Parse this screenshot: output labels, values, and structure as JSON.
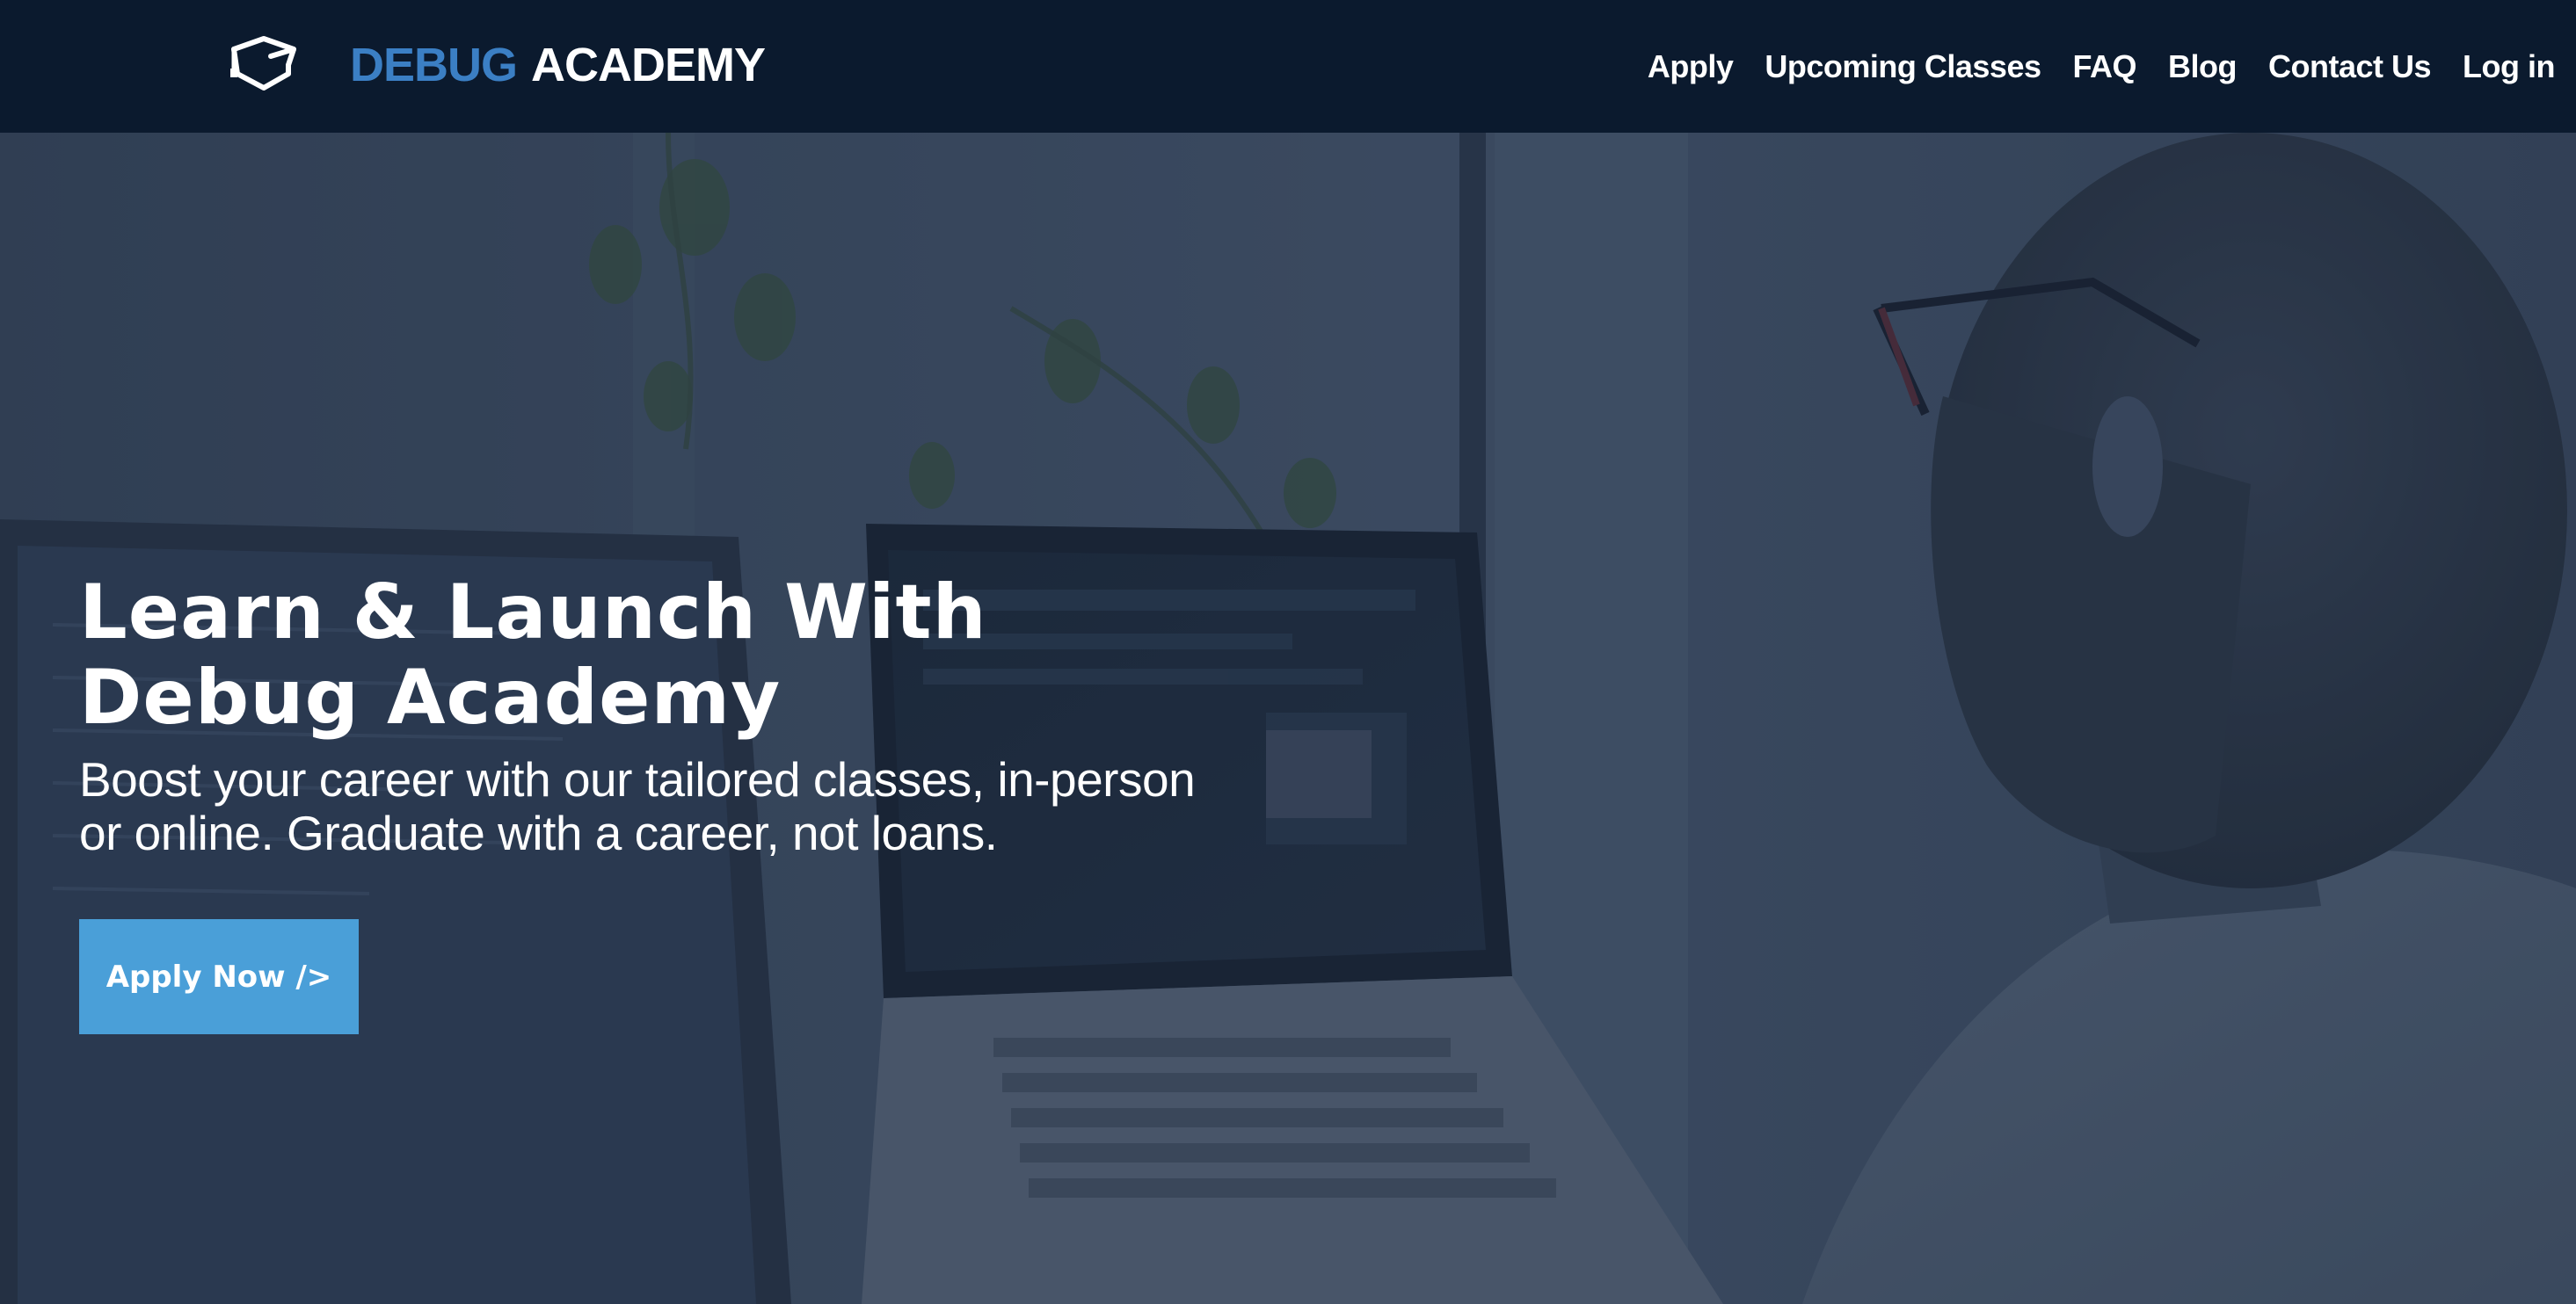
{
  "header": {
    "logo": {
      "word1": "DEBUG",
      "word2": "ACADEMY",
      "icon": "graduation-cap-icon"
    },
    "nav": [
      {
        "label": "Apply"
      },
      {
        "label": "Upcoming Classes"
      },
      {
        "label": "FAQ"
      },
      {
        "label": "Blog"
      },
      {
        "label": "Contact Us"
      },
      {
        "label": "Log in"
      }
    ]
  },
  "hero": {
    "title_line1": "Learn & Launch With",
    "title_line2": "Debug Academy",
    "subtitle_line1": "Boost your career with our tailored classes, in-person",
    "subtitle_line2": "or online. Graduate with a career, not loans.",
    "cta_label": "Apply Now />",
    "background": "man-working-on-laptop-photo"
  },
  "colors": {
    "header_bg": "#0b1a2e",
    "logo_accent": "#3b7fc4",
    "cta_bg": "#4a9fd8",
    "text": "#ffffff"
  }
}
